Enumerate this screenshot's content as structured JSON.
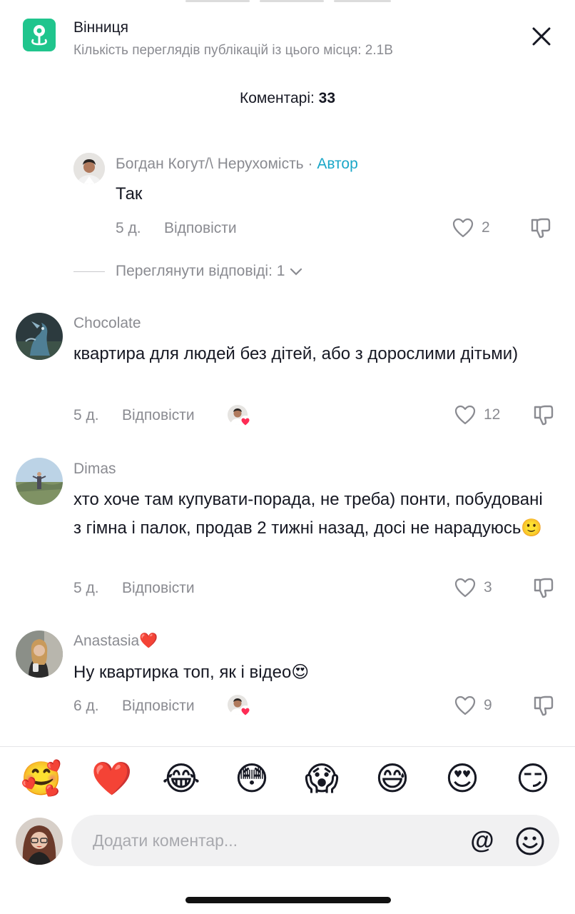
{
  "place": {
    "name": "Вінниця",
    "views": "Кількість переглядів публікацій із цього місця: 2.1B",
    "icon": "location-pin-icon",
    "icon_color": "#20c58d"
  },
  "header": {
    "title_prefix": "Коментарі: ",
    "count": "33"
  },
  "comments": [
    {
      "user": "Богдан Когут/\\ Нерухомість",
      "separator": "·",
      "author_label": "Автор",
      "text": "Так",
      "time": "5 д.",
      "reply_label": "Відповісти",
      "likes": "2"
    },
    {
      "user": "Chocolate",
      "text": "квартира для людей без дітей, або з дорослими дітьми)",
      "time": "5 д.",
      "reply_label": "Відповісти",
      "likes": "12"
    },
    {
      "user": "Dimas",
      "text": "хто хоче там купувати-порада, не треба) понти, побудовані з гімна і палок, продав 2 тижні назад, досі не нарадуюсь🙂",
      "time": "5 д.",
      "reply_label": "Відповісти",
      "likes": "3"
    },
    {
      "user": "Anastasia❤️",
      "text": "Ну квартирка топ, як і відео😍",
      "time": "6 д.",
      "reply_label": "Відповісти",
      "likes": "9"
    }
  ],
  "view_replies": "Переглянути відповіді: 1",
  "emojis": [
    "🥰",
    "❤️",
    "😂",
    "😳",
    "😱",
    "😅",
    "😍",
    "😏"
  ],
  "input": {
    "placeholder": "Додати коментар...",
    "mention": "@"
  },
  "colors": {
    "author": "#1aa7c8",
    "muted": "#8a8b91",
    "like_badge": "#fe2c55"
  }
}
